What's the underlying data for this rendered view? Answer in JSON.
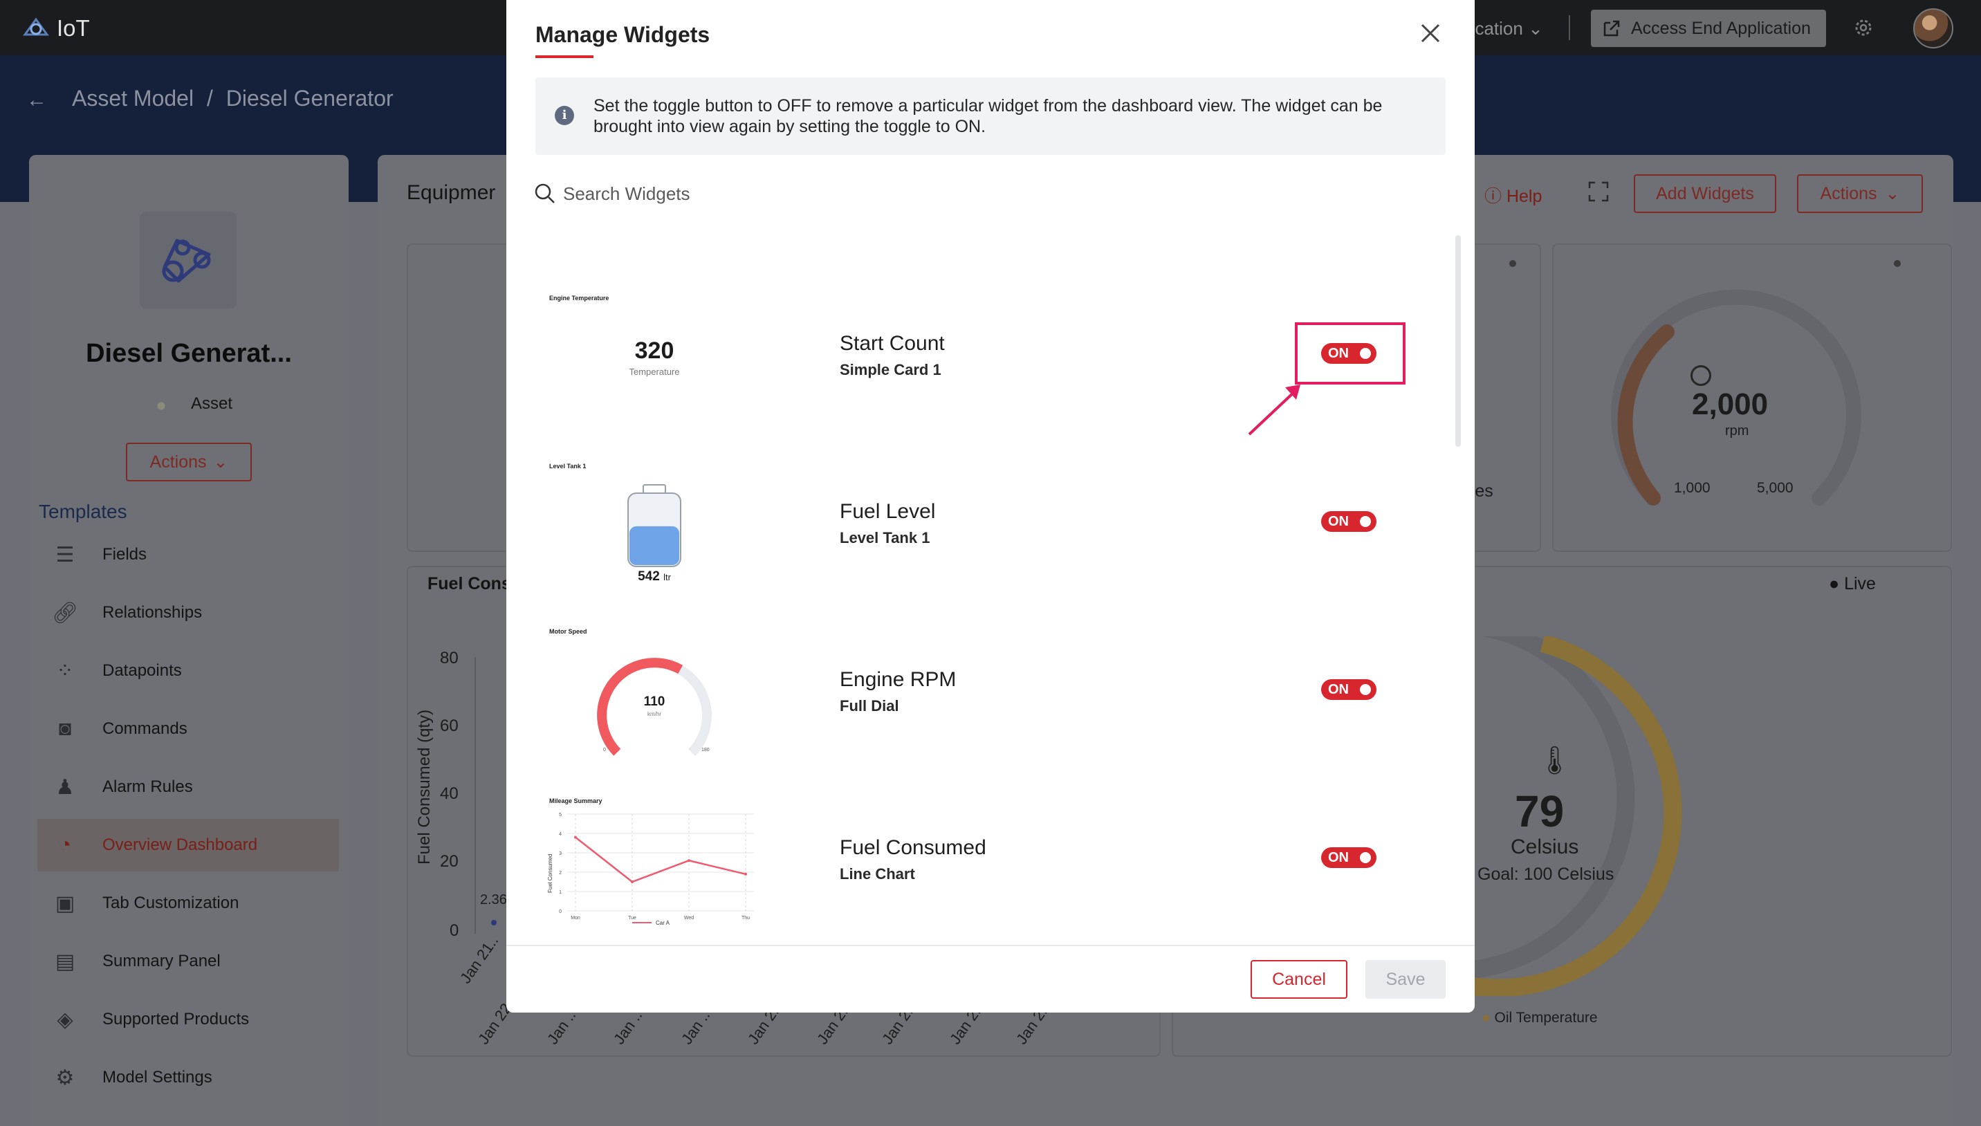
{
  "topbar": {
    "app_title": "IoT",
    "application_partial": "ucation",
    "access_button": "Access End Application"
  },
  "breadcrumb": {
    "parent": "Asset Model",
    "separator": "/",
    "current": "Diesel Generator"
  },
  "asset": {
    "name": "Diesel Generat...",
    "type": "Asset",
    "actions_label": "Actions"
  },
  "sidebar": {
    "section_title": "Templates",
    "items": [
      {
        "label": "Fields",
        "icon": "fields-icon"
      },
      {
        "label": "Relationships",
        "icon": "link-icon"
      },
      {
        "label": "Datapoints",
        "icon": "datapoints-icon"
      },
      {
        "label": "Commands",
        "icon": "gamepad-icon"
      },
      {
        "label": "Alarm Rules",
        "icon": "bell-icon"
      },
      {
        "label": "Overview Dashboard",
        "icon": "dashboard-icon",
        "active": true
      },
      {
        "label": "Tab Customization",
        "icon": "tab-icon"
      },
      {
        "label": "Summary Panel",
        "icon": "id-card-icon"
      },
      {
        "label": "Supported Products",
        "icon": "box-icon"
      },
      {
        "label": "Model Settings",
        "icon": "gear-icon"
      }
    ]
  },
  "main": {
    "title_partial": "Equipmer",
    "help_label": "Help",
    "add_widgets_label": "Add Widgets",
    "actions_label": "Actions",
    "fuel_card_title_partial": "Fuel Cons",
    "fuel_y_axis_label": "Fuel Consumed (qty)",
    "fuel_y_ticks": [
      "80",
      "60",
      "40",
      "20",
      "0"
    ],
    "fuel_first_value": "2.36",
    "fuel_x_tick_partials": [
      "Jan 21..",
      "Jan 22..",
      "Jan ..",
      "Jan ..",
      "Jan ..",
      "Jan 2..",
      "Jan 2..",
      "Jan 2..",
      "Jan 2..",
      "Jan 2.."
    ],
    "res_partial": "res",
    "rpm": {
      "value": "2,000",
      "unit": "rpm",
      "min": "1,000",
      "max": "5,000"
    },
    "live_label": "Live",
    "temperature": {
      "value": "79",
      "unit": "Celsius",
      "goal": "Goal: 100 Celsius",
      "legend": "Oil Temperature"
    }
  },
  "modal": {
    "title": "Manage Widgets",
    "info_text": "Set the toggle button to OFF to remove a particular widget from the dashboard view. The widget can be brought into view again by setting the toggle to ON.",
    "search_placeholder": "Search Widgets",
    "cancel_label": "Cancel",
    "save_label": "Save",
    "widgets": [
      {
        "name": "Start Count",
        "type": "Simple Card 1",
        "toggle": "ON",
        "thumb": {
          "title": "Engine Temperature",
          "value": "320",
          "caption": "Temperature"
        }
      },
      {
        "name": "Fuel Level",
        "type": "Level Tank 1",
        "toggle": "ON",
        "thumb": {
          "title": "Level Tank 1",
          "value": "542",
          "unit": "ltr",
          "fill_fraction": 0.55
        }
      },
      {
        "name": "Engine RPM",
        "type": "Full Dial",
        "toggle": "ON",
        "thumb": {
          "title": "Motor Speed",
          "value": "110",
          "unit": "km/hr",
          "min": "0",
          "max": "180",
          "fraction": 0.61
        }
      },
      {
        "name": "Fuel Consumed",
        "type": "Line Chart",
        "toggle": "ON",
        "thumb": {
          "title": "Mileage Summary",
          "ylabel": "Fuel Consumed",
          "legend": "Car A"
        }
      }
    ]
  },
  "chart_data": {
    "type": "line",
    "title": "Mileage Summary",
    "xlabel": "",
    "ylabel": "Fuel Consumed",
    "categories": [
      "Mon",
      "Tue",
      "Wed",
      "Thu"
    ],
    "series": [
      {
        "name": "Car A",
        "values": [
          3.8,
          1.5,
          2.6,
          1.9
        ]
      }
    ],
    "ylim": [
      0,
      5
    ],
    "y_ticks": [
      "0",
      "1",
      "2",
      "3",
      "4",
      "5"
    ],
    "grid": true,
    "legend": "bottom"
  },
  "colors": {
    "accent": "#d7262d",
    "highlight": "#e21d60",
    "gauge_orange": "#e07a3a",
    "gauge_yellow": "#f2b824",
    "tank_fill": "#6fa3e8"
  }
}
